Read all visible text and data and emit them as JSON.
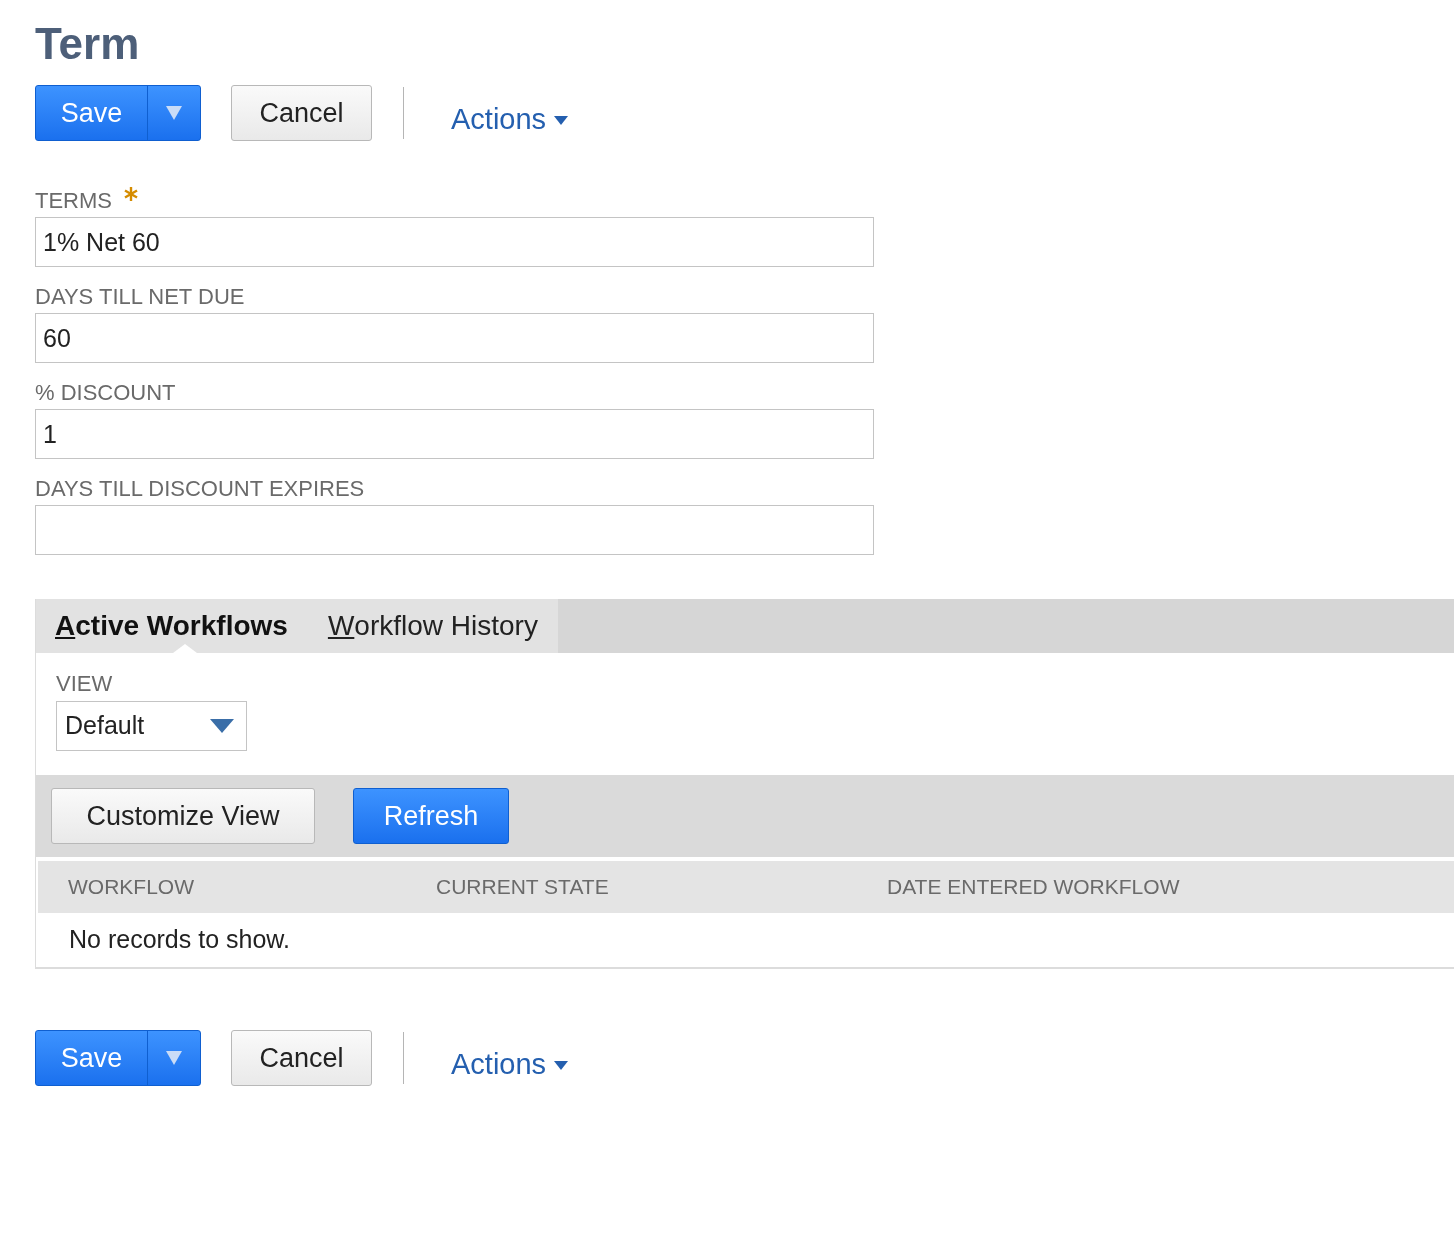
{
  "title": "Term",
  "toolbars": [
    {
      "save": "Save",
      "cancel": "Cancel",
      "actions": "Actions"
    },
    {
      "save": "Save",
      "cancel": "Cancel",
      "actions": "Actions"
    }
  ],
  "fields": [
    {
      "label": "TERMS",
      "required": true,
      "value": "1% Net 60"
    },
    {
      "label": "DAYS TILL NET DUE",
      "required": false,
      "value": "60"
    },
    {
      "label": "% DISCOUNT",
      "required": false,
      "value": "1"
    },
    {
      "label": "DAYS TILL DISCOUNT EXPIRES",
      "required": false
    }
  ],
  "tabs": [
    {
      "label": "Active Workflows",
      "selected": true
    },
    {
      "label": "Workflow History",
      "selected": false
    }
  ],
  "view": {
    "label": "VIEW",
    "value": "Default"
  },
  "buttons": {
    "customize": "Customize View",
    "refresh": "Refresh"
  },
  "table": {
    "columns": [
      "WORKFLOW",
      "CURRENT STATE",
      "DATE ENTERED WORKFLOW"
    ],
    "empty": "No records to show."
  }
}
